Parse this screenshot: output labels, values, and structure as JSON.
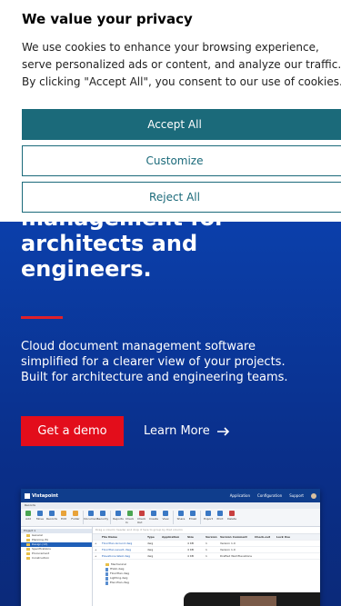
{
  "hero": {
    "title_line1": "management for",
    "title_line2": "architects and",
    "title_line3": "engineers.",
    "description": "Cloud document management software simplified for a clearer view of your projects. Built for architecture and engineering teams.",
    "demo_button": "Get a demo",
    "learn_more": "Learn More",
    "accent_color": "#e30d1b"
  },
  "cookie_banner": {
    "title": "We value your privacy",
    "text": "We use cookies to enhance your browsing experience, serve personalized ads or content, and analyze our traffic. By clicking \"Accept All\", you consent to our use of cookies.",
    "accept": "Accept All",
    "customize": "Customize",
    "reject": "Reject All",
    "button_color": "#1b6a7a"
  },
  "app_preview": {
    "brand": "Vistapoint",
    "menu": [
      "Application",
      "Configuration",
      "Support"
    ],
    "breadcrumb": "Records",
    "ribbon": [
      "Add",
      "Move",
      "Records",
      "Edit",
      "Folder",
      "Open",
      "Document",
      "Security",
      "Reports",
      "Check In",
      "Check Out",
      "Create",
      "View",
      "Unlock",
      "Lock",
      "Share",
      "Email",
      "Export",
      "Print",
      "Delete"
    ],
    "tree_header": "Project 1",
    "tree": [
      "General",
      "Planning (5)",
      "Design (13)",
      "Specifications",
      "Procurement",
      "Construction"
    ],
    "search_placeholder": "Drag a column header and drop it here to group by that column",
    "columns": [
      "",
      "File Name",
      "Type",
      "Application",
      "Size",
      "Version",
      "Version Comment",
      "Check-out",
      "Lock Use"
    ],
    "rows": [
      [
        "+",
        "FloorPlan-Ground.dwg",
        "dwg",
        "",
        "4 KB",
        "1",
        "Version 1.0",
        "",
        ""
      ],
      [
        "+",
        "FloorPlan-Level1.dwg",
        "dwg",
        "",
        "4 KB",
        "1",
        "Version 1.0",
        "",
        ""
      ],
      [
        "+",
        "Elevations-West.dwg",
        "dwg",
        "",
        "4 KB",
        "1",
        "Drafted Wall Elevations",
        "",
        ""
      ]
    ],
    "sub_folder": "Mechanical",
    "sub_items": [
      "HVAC.dwg",
      "FloorPlan.dwg",
      "Lighting.dwg",
      "Elec-Plan.dwg"
    ]
  }
}
